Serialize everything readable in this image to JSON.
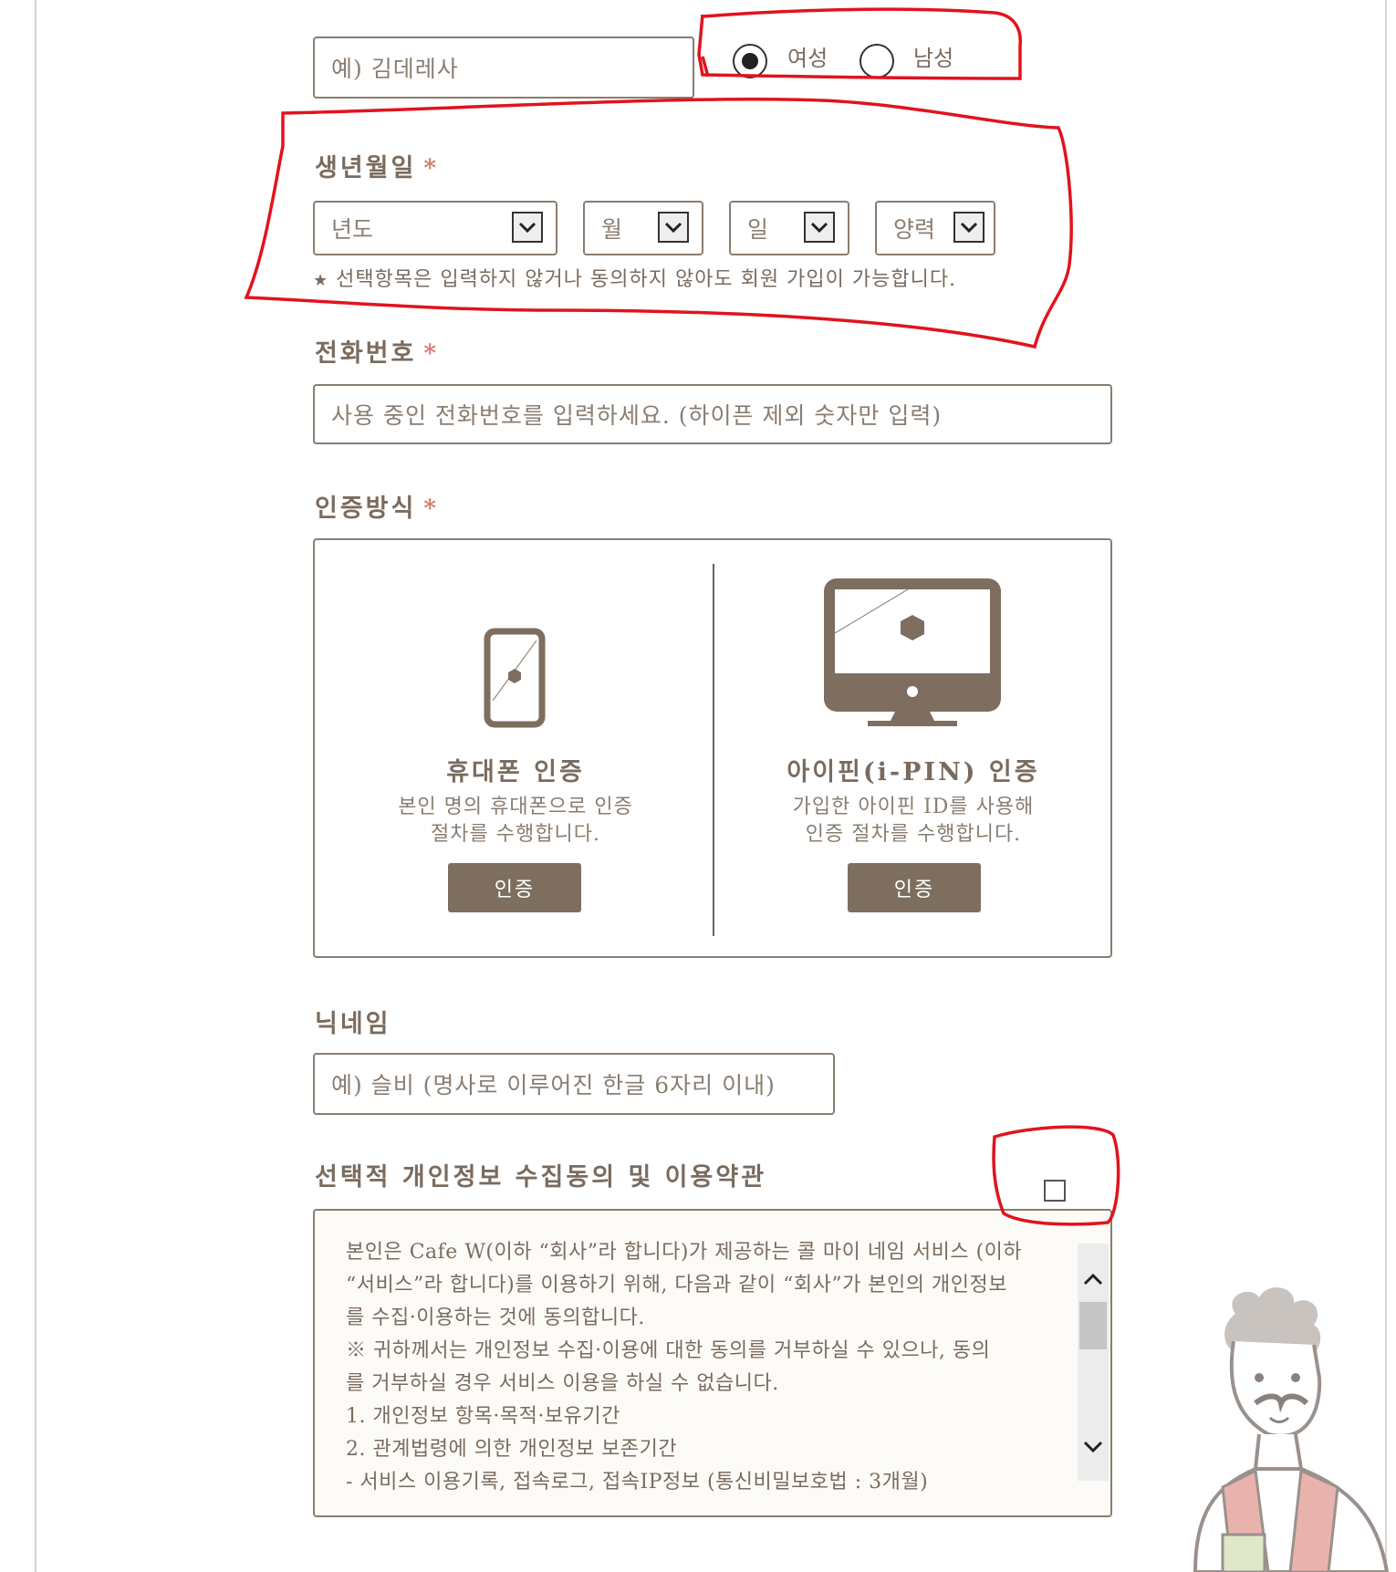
{
  "name_field": {
    "placeholder": "예) 김데레사"
  },
  "gender": {
    "options": [
      {
        "label": "여성",
        "selected": true
      },
      {
        "label": "남성",
        "selected": false
      }
    ]
  },
  "birthdate": {
    "label": "생년월일",
    "required_mark": "*",
    "year": "년도",
    "month": "월",
    "day": "일",
    "calendar": "양력",
    "note": "선택항목은 입력하지 않거나 동의하지 않아도 회원 가입이 가능합니다."
  },
  "phone": {
    "label": "전화번호",
    "required_mark": "*",
    "placeholder": "사용 중인 전화번호를 입력하세요. (하이픈 제외 숫자만 입력)"
  },
  "auth": {
    "label": "인증방식",
    "required_mark": "*",
    "mobile": {
      "title": "휴대폰 인증",
      "desc_line1": "본인 명의 휴대폰으로 인증",
      "desc_line2": "절차를 수행합니다.",
      "button": "인증"
    },
    "ipin": {
      "title": "아이핀(i-PIN) 인증",
      "desc_line1": "가입한 아이핀 ID를 사용해",
      "desc_line2": "인증 절차를 수행합니다.",
      "button": "인증"
    }
  },
  "nickname": {
    "label": "닉네임",
    "placeholder": "예) 슬비 (명사로 이루어진 한글 6자리 이내)"
  },
  "terms": {
    "label": "선택적 개인정보 수집동의 및 이용약관",
    "lines": [
      "본인은 Cafe W(이하 “회사”라 합니다)가 제공하는 콜 마이 네임 서비스 (이하",
      "“서비스”라 합니다)를 이용하기 위해, 다음과 같이 “회사”가 본인의 개인정보",
      "를 수집·이용하는 것에 동의합니다.",
      "※ 귀하께서는 개인정보 수집·이용에 대한 동의를 거부하실 수 있으나, 동의",
      "를 거부하실 경우 서비스 이용을 하실 수 없습니다.",
      "1. 개인정보 항목·목적·보유기간",
      "2. 관계법령에 의한 개인정보 보존기간",
      "- 서비스 이용기록, 접속로그, 접속IP정보 (통신비밀보호법 : 3개월)"
    ],
    "agree_checked": false
  },
  "colors": {
    "brand": "#7d6e5f",
    "required": "#d47b6a",
    "annotation": "#e0141e"
  }
}
